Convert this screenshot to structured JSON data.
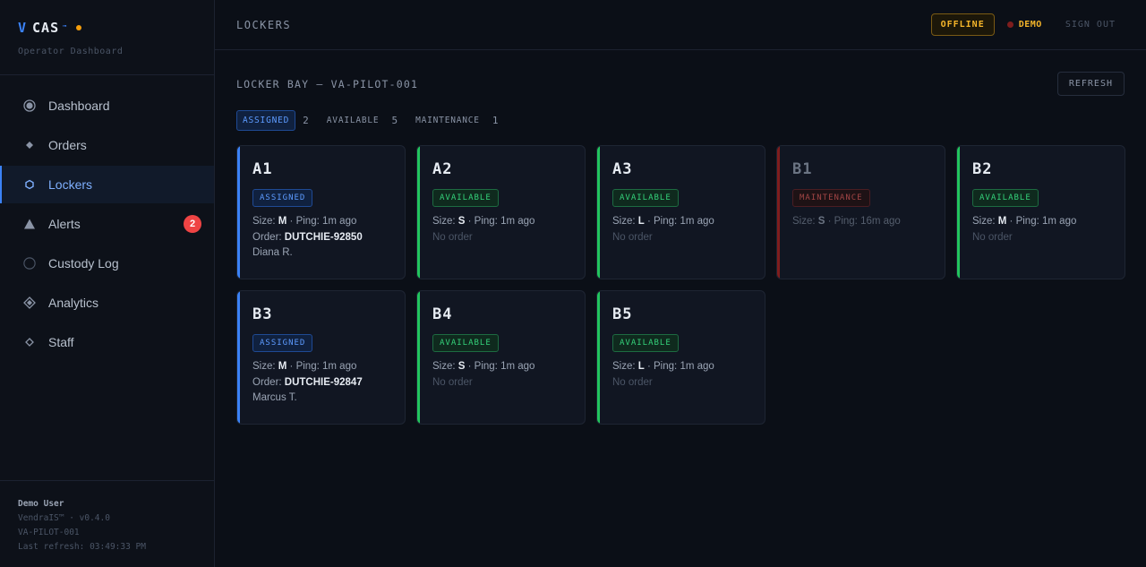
{
  "brand": {
    "v": "V",
    "cas": "CAS",
    "tm": "™",
    "subtitle": "Operator Dashboard"
  },
  "nav": [
    {
      "label": "Dashboard",
      "icon": "dashboard-icon"
    },
    {
      "label": "Orders",
      "icon": "orders-icon"
    },
    {
      "label": "Lockers",
      "icon": "lockers-icon",
      "active": true
    },
    {
      "label": "Alerts",
      "icon": "alerts-icon",
      "badge": "2"
    },
    {
      "label": "Custody Log",
      "icon": "custody-log-icon"
    },
    {
      "label": "Analytics",
      "icon": "analytics-icon"
    },
    {
      "label": "Staff",
      "icon": "staff-icon"
    }
  ],
  "footer": {
    "user": "Demo User",
    "version": "VendraIS™ · v0.4.0",
    "site": "VA-PILOT-001",
    "last_refresh": "Last refresh: 03:49:33 PM"
  },
  "topbar": {
    "title": "LOCKERS",
    "offline": "OFFLINE",
    "demo": "DEMO",
    "signout": "SIGN OUT"
  },
  "main": {
    "bay_title": "LOCKER BAY — VA-PILOT-001",
    "refresh": "REFRESH",
    "filters": [
      {
        "label": "ASSIGNED",
        "count": "2",
        "active": true
      },
      {
        "label": "AVAILABLE",
        "count": "5"
      },
      {
        "label": "MAINTENANCE",
        "count": "1"
      }
    ]
  },
  "lockers": [
    {
      "id": "A1",
      "status": "ASSIGNED",
      "size": "M",
      "ping": "1m ago",
      "order": "DUTCHIE-92850",
      "customer": "Diana R."
    },
    {
      "id": "A2",
      "status": "AVAILABLE",
      "size": "S",
      "ping": "1m ago",
      "order_text": "No order"
    },
    {
      "id": "A3",
      "status": "AVAILABLE",
      "size": "L",
      "ping": "1m ago",
      "order_text": "No order"
    },
    {
      "id": "B1",
      "status": "MAINTENANCE",
      "size": "S",
      "ping": "16m ago"
    },
    {
      "id": "B2",
      "status": "AVAILABLE",
      "size": "M",
      "ping": "1m ago",
      "order_text": "No order"
    },
    {
      "id": "B3",
      "status": "ASSIGNED",
      "size": "M",
      "ping": "1m ago",
      "order": "DUTCHIE-92847",
      "customer": "Marcus T."
    },
    {
      "id": "B4",
      "status": "AVAILABLE",
      "size": "S",
      "ping": "1m ago",
      "order_text": "No order"
    },
    {
      "id": "B5",
      "status": "AVAILABLE",
      "size": "L",
      "ping": "1m ago",
      "order_text": "No order"
    }
  ],
  "labels": {
    "size": "Size: ",
    "ping": " · Ping: ",
    "order": "Order: "
  },
  "colors": {
    "accent": "#3b82f6",
    "available": "#22c55e",
    "maintenance": "#7f1d1d",
    "warning": "#f5b52a",
    "alert": "#ef4444"
  }
}
